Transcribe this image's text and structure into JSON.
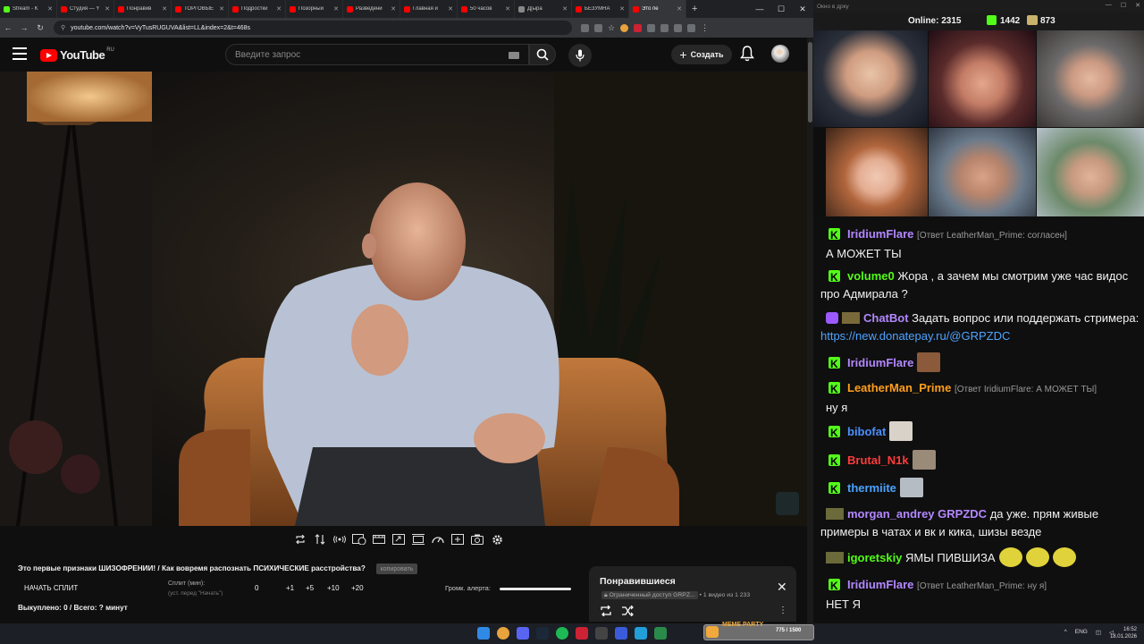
{
  "browser": {
    "tabs": [
      {
        "label": "Stream - K",
        "color": "#53fc18"
      },
      {
        "label": "Студия — Y",
        "color": "#ff0000"
      },
      {
        "label": "Понравив",
        "color": "#ff0000"
      },
      {
        "label": "ТОРГОВЫЕ",
        "color": "#ff0000"
      },
      {
        "label": "Подростки",
        "color": "#ff0000"
      },
      {
        "label": "Позорный",
        "color": "#ff0000"
      },
      {
        "label": "Разведени",
        "color": "#ff0000"
      },
      {
        "label": "Главная и",
        "color": "#ff0000"
      },
      {
        "label": "50 часов",
        "color": "#ff0000"
      },
      {
        "label": "Д[ыра",
        "color": "#888888"
      },
      {
        "label": "БЕЗУМНА",
        "color": "#ff0000"
      },
      {
        "label": "Это пе",
        "color": "#ff0000",
        "active": true
      }
    ],
    "url": "youtube.com/watch?v=VyTusRUGUVA&list=LL&index=2&t=468s"
  },
  "youtube": {
    "logo_text": "YouTube",
    "region": "RU",
    "search_placeholder": "Введите запрос",
    "create_label": "Создать"
  },
  "video": {
    "title": "Это первые признаки ШИЗОФРЕНИИ! / Как вовремя распознать ПСИХИЧЕСКИЕ расстройства?",
    "copy_label": "копировать"
  },
  "split": {
    "start_label": "НАЧАТЬ СПЛИТ",
    "label": "Сплит (мин):",
    "hint": "(уст. перед \"Начать\")",
    "value": "0",
    "increments": [
      "+1",
      "+5",
      "+10",
      "+20"
    ],
    "alert_label": "Громк. алерта:",
    "alert_volume": 1.0,
    "bought": "Выкуплено: 0 / Всего: ? минут"
  },
  "liked": {
    "title": "Понравившиеся",
    "access": "Ограниченный доступ",
    "channel": "GRPZ...",
    "count": "• 1 видео из 1 233"
  },
  "stream": {
    "window_title": "Окно в дрку",
    "online_label": "Online:",
    "online": "2315",
    "followers": "1442",
    "subs": "873"
  },
  "chat": [
    {
      "user": "IridiumFlare",
      "color": "#b388ff",
      "reply": "[Ответ LeatherMan_Prime: согласен]",
      "text": "А МОЖЕТ ТЫ"
    },
    {
      "user": "volume0",
      "color": "#53fc18",
      "text": "Жора , а зачем мы смотрим уже час видос про Адмирала ?"
    },
    {
      "user": "ChatBot",
      "color": "#b388ff",
      "text": "Задать вопрос или поддержать стримера:",
      "link": "https://new.donatepay.ru/@GRPZDC"
    },
    {
      "user": "IridiumFlare",
      "color": "#b388ff",
      "text": ""
    },
    {
      "user": "LeatherMan_Prime",
      "color": "#ff9f1c",
      "reply": "[Ответ IridiumFlare: А МОЖЕТ ТЫ]",
      "text": "ну я"
    },
    {
      "user": "bibofat",
      "color": "#4a90ff",
      "text": ""
    },
    {
      "user": "Brutal_N1k",
      "color": "#ff3b3b",
      "text": ""
    },
    {
      "user": "thermiite",
      "color": "#4aa3ff",
      "text": ""
    },
    {
      "user": "morgan_andrey",
      "color": "#b388ff",
      "mention": "GRPZDC",
      "text": "да уже. прям живые примеры в чатах и вк и кика, шизы везде"
    },
    {
      "user": "igoretskiy",
      "color": "#53fc18",
      "text": "ЯМЫ ПИВШИЗА"
    },
    {
      "user": "IridiumFlare",
      "color": "#b388ff",
      "reply": "[Ответ LeatherMan_Prime: ну я]",
      "text": "НЕТ Я"
    }
  ],
  "taskbar": {
    "meme_label": "MEME PARTY",
    "meme_progress": "775 / 1500",
    "lang": "ENG",
    "time": "16:52",
    "date": "18.01.2026"
  }
}
